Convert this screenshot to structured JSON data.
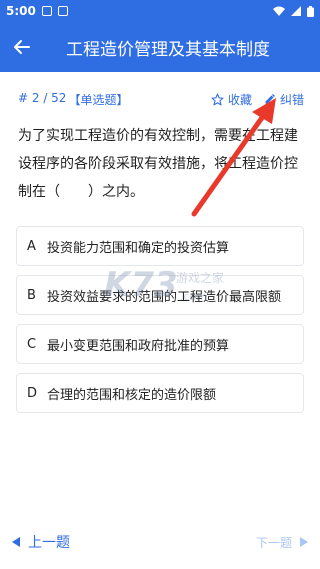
{
  "status_bar": {
    "time": "5:00"
  },
  "app_bar": {
    "title": "工程造价管理及其基本制度"
  },
  "question": {
    "number": "# 2 / 52",
    "type": "【单选题】",
    "favorite_label": "收藏",
    "report_label": "纠错",
    "text": "为了实现工程造价的有效控制，需要在工程建设程序的各阶段采取有效措施，将工程造价控制在（　　）之内。"
  },
  "options": [
    {
      "letter": "A",
      "text": "投资能力范围和确定的投资估算"
    },
    {
      "letter": "B",
      "text": "投资效益要求的范围的工程造价最高限额"
    },
    {
      "letter": "C",
      "text": "最小变更范围和政府批准的预算"
    },
    {
      "letter": "D",
      "text": "合理的范围和核定的造价限额"
    }
  ],
  "nav": {
    "prev_label": "上一题",
    "next_label": "下一题"
  },
  "watermark": {
    "logo": "K73",
    "text": "游戏之家",
    "url": ".com"
  },
  "colors": {
    "primary": "#2f6de2",
    "disabled": "#aac6f5",
    "annotation_arrow": "#e8392b"
  }
}
